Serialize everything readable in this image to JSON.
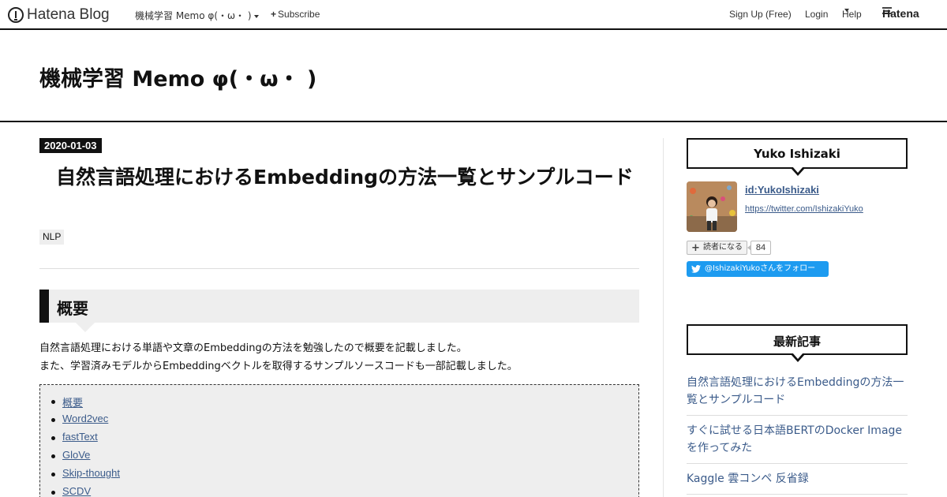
{
  "topbar": {
    "logo_text": "Hatena Blog",
    "blog_menu_label": "機械学習 Memo φ(・ω・ )",
    "subscribe_label": "Subscribe",
    "signup_label": "Sign Up (Free)",
    "login_label": "Login",
    "help_label": "Help",
    "brand_label": "Hatena"
  },
  "header": {
    "blog_title": "機械学習 Memo φ(・ω・ )"
  },
  "entry": {
    "date": "2020-01-03",
    "title": "自然言語処理におけるEmbeddingの方法一覧とサンプルコード",
    "category": "NLP",
    "section_heading": "概要",
    "paragraph_1": "自然言語処理における単語や文章のEmbeddingの方法を勉強したので概要を記載しました。",
    "paragraph_2": "また、学習済みモデルからEmbeddingベクトルを取得するサンプルソースコードも一部記載しました。",
    "toc": [
      "概要",
      "Word2vec",
      "fastText",
      "GloVe",
      "Skip-thought",
      "SCDV"
    ]
  },
  "sidebar": {
    "profile": {
      "heading": "Yuko Ishizaki",
      "user_id": "id:YukoIshizaki",
      "twitter_url": "https://twitter.com/IshizakiYuko",
      "reader_button_label": "読者になる",
      "reader_count": "84",
      "follow_button_label": "@IshizakiYukoさんをフォロー"
    },
    "recent": {
      "heading": "最新記事",
      "items": [
        "自然言語処理におけるEmbeddingの方法一覧とサンプルコード",
        "すぐに試せる日本語BERTのDocker Imageを作ってみた",
        "Kaggle 雲コンペ 反省録"
      ]
    }
  },
  "colors": {
    "link": "#3b5b8a",
    "twitter": "#1d9bf0",
    "ink": "#111111",
    "panel": "#eeeeee"
  }
}
